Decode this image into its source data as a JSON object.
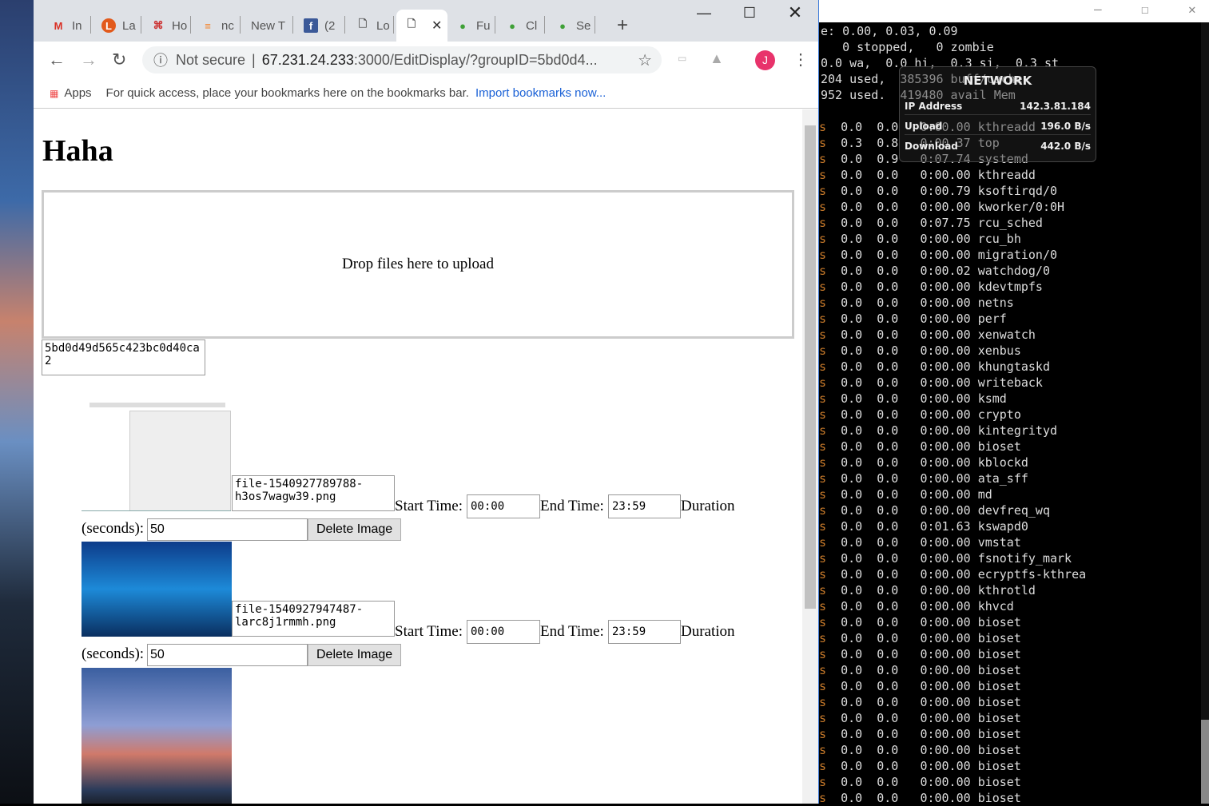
{
  "browser": {
    "tabs": [
      {
        "label": "In",
        "icon": "gmail-icon"
      },
      {
        "label": "La",
        "icon": "l-icon"
      },
      {
        "label": "Ho",
        "icon": "os-icon"
      },
      {
        "label": "nc",
        "icon": "stackoverflow-icon"
      },
      {
        "label": "New T",
        "icon": ""
      },
      {
        "label": "(2",
        "icon": "facebook-icon"
      },
      {
        "label": "Lo",
        "icon": "page-icon"
      },
      {
        "label": "",
        "icon": "page-icon",
        "active": true
      },
      {
        "label": "Fu",
        "icon": "mongodb-leaf-icon"
      },
      {
        "label": "Cl",
        "icon": "mongodb-leaf-icon"
      },
      {
        "label": "Se",
        "icon": "mongodb-leaf-icon"
      }
    ],
    "new_tab": "+",
    "security": "Not secure",
    "url_host": "67.231.24.233",
    "url_rest": ":3000/EditDisplay/?groupID=5bd0d4...",
    "avatar": "J",
    "avatar_color": "#e8336b",
    "bookmarks": {
      "apps": "Apps",
      "hint": "For quick access, place your bookmarks here on the bookmarks bar.",
      "import": "Import bookmarks now..."
    }
  },
  "page": {
    "title": "Haha",
    "drop_text": "Drop files here to upload",
    "group_id": "5bd0d49d565c423bc0d40ca2",
    "images": [
      {
        "filename": "file-1540927789788-h3os7wagw39.png",
        "start_label": "Start Time:",
        "start": "00:00",
        "end_label": "End Time:",
        "end": "23:59",
        "duration_label": "Duration",
        "seconds_label": "(seconds):",
        "duration": "50",
        "delete": "Delete Image"
      },
      {
        "filename": "file-1540927947487-larc8j1rmmh.png",
        "start_label": "Start Time:",
        "start": "00:00",
        "end_label": "End Time:",
        "end": "23:59",
        "duration_label": "Duration",
        "seconds_label": "(seconds):",
        "duration": "50",
        "delete": "Delete Image"
      }
    ]
  },
  "terminal": {
    "header": [
      "e: 0.00, 0.03, 0.09",
      "   0 stopped,   0 zombie",
      "0.0 wa,  0.0 hi,  0.3 si,  0.3 st",
      "204 used,  385396 buff/cache",
      "952 used.  419480 avail Mem"
    ],
    "rows": [
      [
        "0.0",
        "0.0",
        "0:00.00",
        "kthreadd"
      ],
      [
        "0.3",
        "0.8",
        "0:00.37",
        "top"
      ],
      [
        "0.0",
        "0.9",
        "0:07.74",
        "systemd"
      ],
      [
        "0.0",
        "0.0",
        "0:00.00",
        "kthreadd"
      ],
      [
        "0.0",
        "0.0",
        "0:00.79",
        "ksoftirqd/0"
      ],
      [
        "0.0",
        "0.0",
        "0:00.00",
        "kworker/0:0H"
      ],
      [
        "0.0",
        "0.0",
        "0:07.75",
        "rcu_sched"
      ],
      [
        "0.0",
        "0.0",
        "0:00.00",
        "rcu_bh"
      ],
      [
        "0.0",
        "0.0",
        "0:00.00",
        "migration/0"
      ],
      [
        "0.0",
        "0.0",
        "0:00.02",
        "watchdog/0"
      ],
      [
        "0.0",
        "0.0",
        "0:00.00",
        "kdevtmpfs"
      ],
      [
        "0.0",
        "0.0",
        "0:00.00",
        "netns"
      ],
      [
        "0.0",
        "0.0",
        "0:00.00",
        "perf"
      ],
      [
        "0.0",
        "0.0",
        "0:00.00",
        "xenwatch"
      ],
      [
        "0.0",
        "0.0",
        "0:00.00",
        "xenbus"
      ],
      [
        "0.0",
        "0.0",
        "0:00.00",
        "khungtaskd"
      ],
      [
        "0.0",
        "0.0",
        "0:00.00",
        "writeback"
      ],
      [
        "0.0",
        "0.0",
        "0:00.00",
        "ksmd"
      ],
      [
        "0.0",
        "0.0",
        "0:00.00",
        "crypto"
      ],
      [
        "0.0",
        "0.0",
        "0:00.00",
        "kintegrityd"
      ],
      [
        "0.0",
        "0.0",
        "0:00.00",
        "bioset"
      ],
      [
        "0.0",
        "0.0",
        "0:00.00",
        "kblockd"
      ],
      [
        "0.0",
        "0.0",
        "0:00.00",
        "ata_sff"
      ],
      [
        "0.0",
        "0.0",
        "0:00.00",
        "md"
      ],
      [
        "0.0",
        "0.0",
        "0:00.00",
        "devfreq_wq"
      ],
      [
        "0.0",
        "0.0",
        "0:01.63",
        "kswapd0"
      ],
      [
        "0.0",
        "0.0",
        "0:00.00",
        "vmstat"
      ],
      [
        "0.0",
        "0.0",
        "0:00.00",
        "fsnotify_mark"
      ],
      [
        "0.0",
        "0.0",
        "0:00.00",
        "ecryptfs-kthrea"
      ],
      [
        "0.0",
        "0.0",
        "0:00.00",
        "kthrotld"
      ],
      [
        "0.0",
        "0.0",
        "0:00.00",
        "khvcd"
      ],
      [
        "0.0",
        "0.0",
        "0:00.00",
        "bioset"
      ],
      [
        "0.0",
        "0.0",
        "0:00.00",
        "bioset"
      ],
      [
        "0.0",
        "0.0",
        "0:00.00",
        "bioset"
      ],
      [
        "0.0",
        "0.0",
        "0:00.00",
        "bioset"
      ],
      [
        "0.0",
        "0.0",
        "0:00.00",
        "bioset"
      ],
      [
        "0.0",
        "0.0",
        "0:00.00",
        "bioset"
      ],
      [
        "0.0",
        "0.0",
        "0:00.00",
        "bioset"
      ],
      [
        "0.0",
        "0.0",
        "0:00.00",
        "bioset"
      ],
      [
        "0.0",
        "0.0",
        "0:00.00",
        "bioset"
      ],
      [
        "0.0",
        "0.0",
        "0:00.00",
        "bioset"
      ],
      [
        "0.0",
        "0.0",
        "0:00.00",
        "bioset"
      ],
      [
        "0.0",
        "0.0",
        "0:00.00",
        "bioset"
      ]
    ]
  },
  "network_widget": {
    "title": "NETWORK",
    "ip_label": "IP Address",
    "ip": "142.3.81.184",
    "upload_label": "Upload",
    "upload": "196.0 B/s",
    "download_label": "Download",
    "download": "442.0 B/s"
  }
}
